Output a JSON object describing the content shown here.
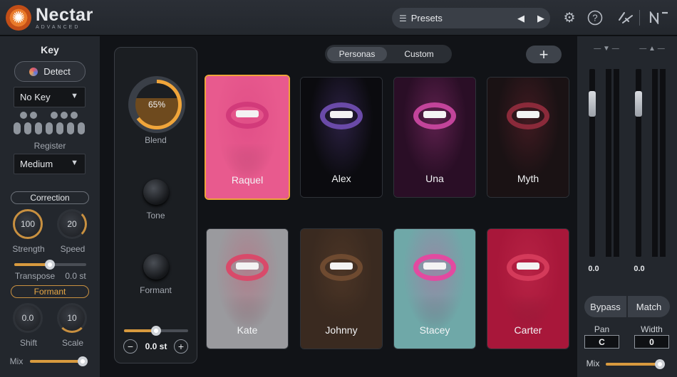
{
  "app": {
    "name": "Nectar",
    "edition": "ADVANCED"
  },
  "header": {
    "presets_label": "Presets"
  },
  "key": {
    "title": "Key",
    "detect_label": "Detect",
    "key_value": "No Key",
    "register_label": "Register",
    "register_value": "Medium"
  },
  "correction": {
    "label": "Correction",
    "strength_value": "100",
    "strength_label": "Strength",
    "speed_value": "20",
    "speed_label": "Speed",
    "transpose_label": "Transpose",
    "transpose_value": "0.0 st"
  },
  "formant_section": {
    "label": "Formant",
    "shift_value": "0.0",
    "shift_label": "Shift",
    "scale_value": "10",
    "scale_label": "Scale",
    "mix_label": "Mix"
  },
  "blend": {
    "value": "65%",
    "level": 0.65,
    "label": "Blend",
    "tone_label": "Tone",
    "formant_label": "Formant",
    "pitch_value": "0.0 st"
  },
  "tabs": [
    {
      "label": "Personas",
      "active": true
    },
    {
      "label": "Custom",
      "active": false
    }
  ],
  "personas": [
    {
      "name": "Raquel",
      "selected": true,
      "bg": "#e85a8e",
      "lip": "#d23a7a"
    },
    {
      "name": "Alex",
      "selected": false,
      "bg": "#0b0b0f",
      "lip": "#6a4aa8"
    },
    {
      "name": "Una",
      "selected": false,
      "bg": "#2a0e26",
      "lip": "#c2449a"
    },
    {
      "name": "Myth",
      "selected": false,
      "bg": "#1a1214",
      "lip": "#8a2a3a"
    },
    {
      "name": "Kate",
      "selected": false,
      "bg": "#9a9a9e",
      "lip": "#d84a6a"
    },
    {
      "name": "Johnny",
      "selected": false,
      "bg": "#3a2a20",
      "lip": "#6e4a30"
    },
    {
      "name": "Stacey",
      "selected": false,
      "bg": "#6fa8a8",
      "lip": "#e24aa0"
    },
    {
      "name": "Carter",
      "selected": false,
      "bg": "#a8173a",
      "lip": "#d43a5a"
    }
  ],
  "output": {
    "left_value": "0.0",
    "right_value": "0.0",
    "bypass_label": "Bypass",
    "match_label": "Match",
    "pan_label": "Pan",
    "pan_value": "C",
    "width_label": "Width",
    "width_value": "0",
    "mix_label": "Mix"
  },
  "colors": {
    "accent": "#f0a53a",
    "panel": "#23272d",
    "background": "#111317"
  }
}
